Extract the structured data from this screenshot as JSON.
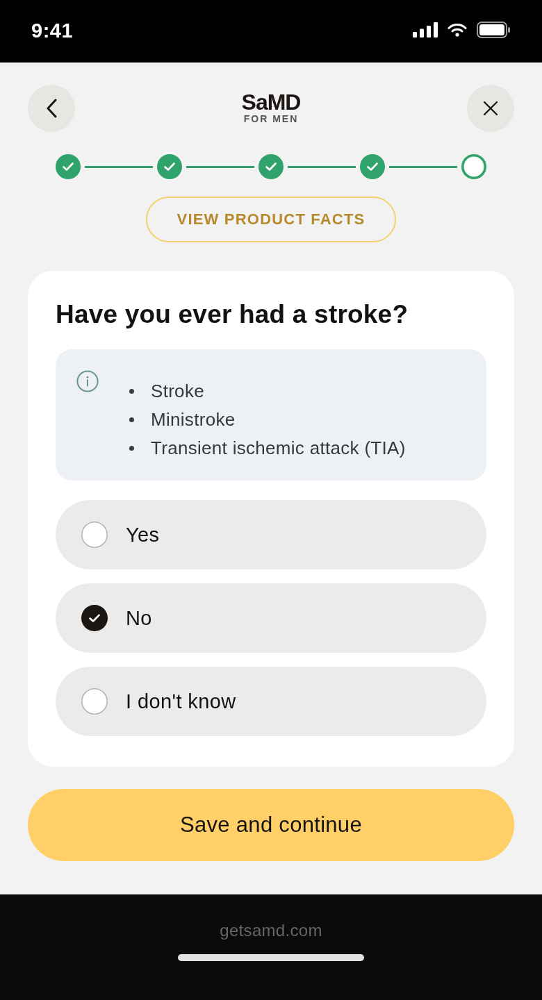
{
  "status_bar": {
    "time": "9:41"
  },
  "header": {
    "logo": {
      "name": "SaMD",
      "tagline": "FOR MEN"
    }
  },
  "progress": {
    "steps": [
      {
        "done": true
      },
      {
        "done": true
      },
      {
        "done": true
      },
      {
        "done": true
      },
      {
        "done": false
      }
    ]
  },
  "facts_button": {
    "label": "VIEW PRODUCT FACTS"
  },
  "question": {
    "title": "Have you ever had a stroke?",
    "info": {
      "items": [
        "Stroke",
        "Ministroke",
        "Transient ischemic attack (TIA)"
      ]
    },
    "options": [
      {
        "label": "Yes",
        "selected": false
      },
      {
        "label": "No",
        "selected": true
      },
      {
        "label": "I don't know",
        "selected": false
      }
    ]
  },
  "primary_button": {
    "label": "Save and continue"
  },
  "browser_bar": {
    "url": "getsamd.com"
  }
}
